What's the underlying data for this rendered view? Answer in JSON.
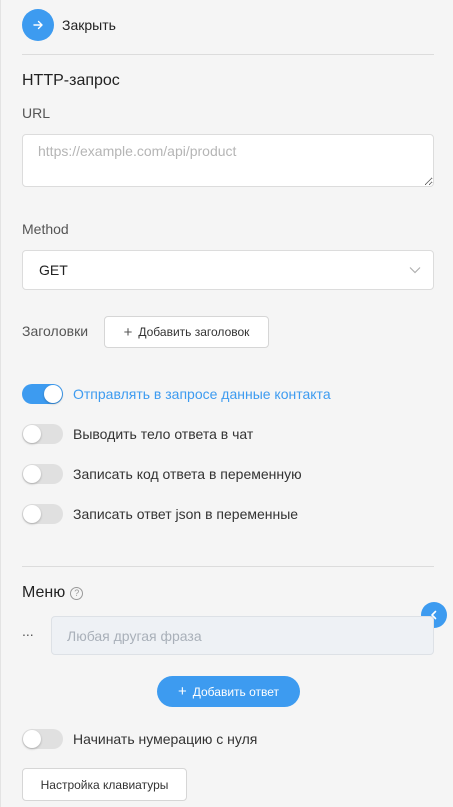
{
  "header": {
    "close_label": "Закрыть"
  },
  "http": {
    "title": "HTTP-запрос",
    "url_label": "URL",
    "url_placeholder": "https://example.com/api/product",
    "url_value": "",
    "method_label": "Method",
    "method_value": "GET",
    "headers_label": "Заголовки",
    "add_header_label": "Добавить заголовок"
  },
  "toggles": [
    {
      "label": "Отправлять в запросе данные контакта",
      "on": true
    },
    {
      "label": "Выводить тело ответа в чат",
      "on": false
    },
    {
      "label": "Записать код ответа в переменную",
      "on": false
    },
    {
      "label": "Записать ответ json в переменные",
      "on": false
    }
  ],
  "menu": {
    "title": "Меню",
    "dots": "...",
    "phrase_placeholder": "Любая другая фраза",
    "add_answer_label": "Добавить ответ",
    "numbering_toggle": {
      "label": "Начинать нумерацию с нуля",
      "on": false
    },
    "keyboard_settings_label": "Настройка клавиатуры"
  },
  "colors": {
    "accent": "#3d9bf0",
    "background": "#f5f5f5"
  },
  "icons": {
    "close": "arrow-right-icon",
    "collapse": "chevron-left-icon",
    "help": "question-circle-icon",
    "select": "chevron-down-icon"
  }
}
